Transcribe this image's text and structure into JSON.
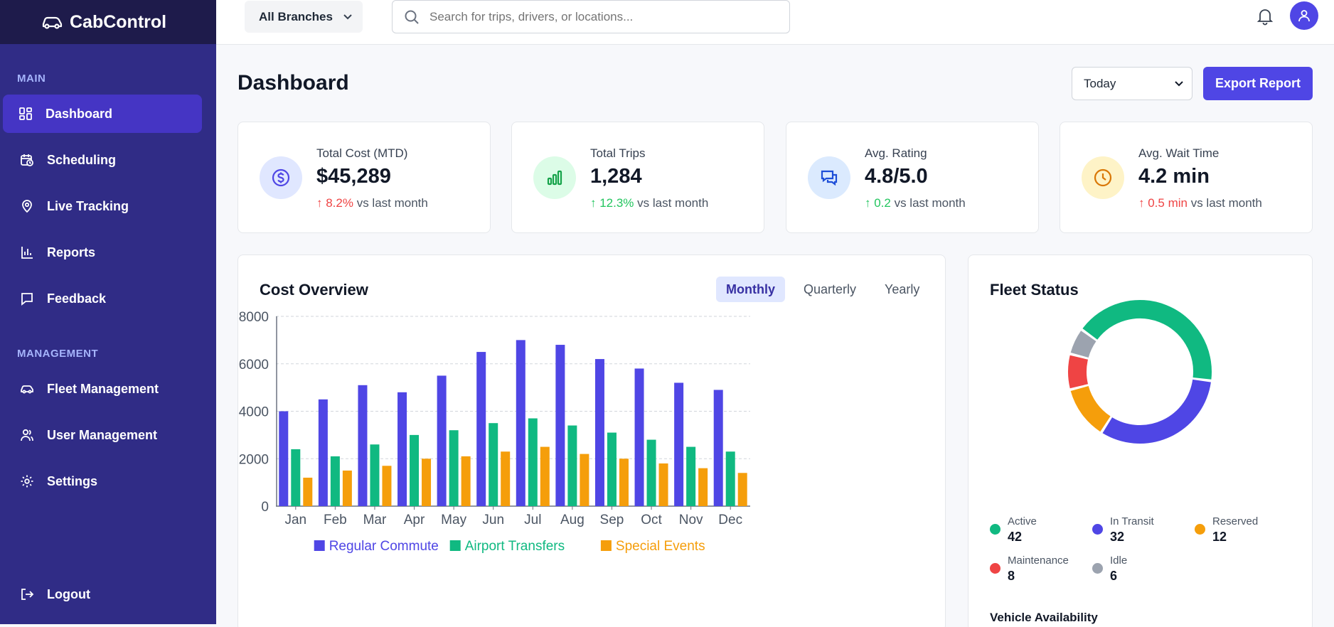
{
  "brand": {
    "name": "CabControl"
  },
  "sidebar": {
    "main_title": "MAIN",
    "main_items": [
      {
        "label": "Dashboard",
        "icon": "dashboard-grid-icon",
        "active": true
      },
      {
        "label": "Scheduling",
        "icon": "calendar-clock-icon"
      },
      {
        "label": "Live Tracking",
        "icon": "map-pin-icon"
      },
      {
        "label": "Reports",
        "icon": "bar-chart-icon"
      },
      {
        "label": "Feedback",
        "icon": "chat-bubble-icon"
      }
    ],
    "management_title": "MANAGEMENT",
    "management_items": [
      {
        "label": "Fleet Management",
        "icon": "car-icon"
      },
      {
        "label": "User Management",
        "icon": "users-icon"
      },
      {
        "label": "Settings",
        "icon": "gear-icon"
      }
    ],
    "logout_label": "Logout"
  },
  "topbar": {
    "branch_label": "All Branches",
    "search_placeholder": "Search for trips, drivers, or locations..."
  },
  "header": {
    "title": "Dashboard",
    "range_value": "Today",
    "export_label": "Export Report"
  },
  "stats": [
    {
      "label": "Total Cost (MTD)",
      "value": "$45,289",
      "change": "↑ 8.2%",
      "change_suffix": " vs last month",
      "trend_color": "#ef4444",
      "icon": "dollar-icon",
      "icon_color": "#4f46e5",
      "icon_bg": "#e0e7ff"
    },
    {
      "label": "Total Trips",
      "value": "1,284",
      "change": "↑ 12.3%",
      "change_suffix": " vs last month",
      "trend_color": "#22c55e",
      "icon": "bar-chart-icon",
      "icon_color": "#16a34a",
      "icon_bg": "#dcfce7"
    },
    {
      "label": "Avg. Rating",
      "value": "4.8/5.0",
      "change": "↑ 0.2",
      "change_suffix": " vs last month",
      "trend_color": "#22c55e",
      "icon": "chat-bubbles-icon",
      "icon_color": "#1d4ed8",
      "icon_bg": "#dbeafe"
    },
    {
      "label": "Avg. Wait Time",
      "value": "4.2 min",
      "change": "↑ 0.5 min",
      "change_suffix": " vs last month",
      "trend_color": "#ef4444",
      "icon": "clock-icon",
      "icon_color": "#d97706",
      "icon_bg": "#fef3c7"
    }
  ],
  "cost_overview": {
    "title": "Cost Overview",
    "tabs": [
      "Monthly",
      "Quarterly",
      "Yearly"
    ],
    "active_tab": "Monthly"
  },
  "chart_data": {
    "type": "bar",
    "categories": [
      "Jan",
      "Feb",
      "Mar",
      "Apr",
      "May",
      "Jun",
      "Jul",
      "Aug",
      "Sep",
      "Oct",
      "Nov",
      "Dec"
    ],
    "series": [
      {
        "name": "Regular Commute",
        "color": "#4f46e5",
        "values": [
          4000,
          4500,
          5100,
          4800,
          5500,
          6500,
          7000,
          6800,
          6200,
          5800,
          5200,
          4900
        ]
      },
      {
        "name": "Airport Transfers",
        "color": "#10b981",
        "values": [
          2400,
          2100,
          2600,
          3000,
          3200,
          3500,
          3700,
          3400,
          3100,
          2800,
          2500,
          2300
        ]
      },
      {
        "name": "Special Events",
        "color": "#f59e0b",
        "values": [
          1200,
          1500,
          1700,
          2000,
          2100,
          2300,
          2500,
          2200,
          2000,
          1800,
          1600,
          1400
        ]
      }
    ],
    "ylim": [
      0,
      8000
    ],
    "yticks": [
      0,
      2000,
      4000,
      6000,
      8000
    ],
    "grid": true,
    "legend_position": "bottom"
  },
  "fleet_status": {
    "title": "Fleet Status",
    "items": [
      {
        "label": "Active",
        "value": 42,
        "color": "#10b981"
      },
      {
        "label": "In Transit",
        "value": 32,
        "color": "#4f46e5"
      },
      {
        "label": "Reserved",
        "value": 12,
        "color": "#f59e0b"
      },
      {
        "label": "Maintenance",
        "value": 8,
        "color": "#ef4444"
      },
      {
        "label": "Idle",
        "value": 6,
        "color": "#9ca3af"
      }
    ],
    "availability_title": "Vehicle Availability"
  }
}
